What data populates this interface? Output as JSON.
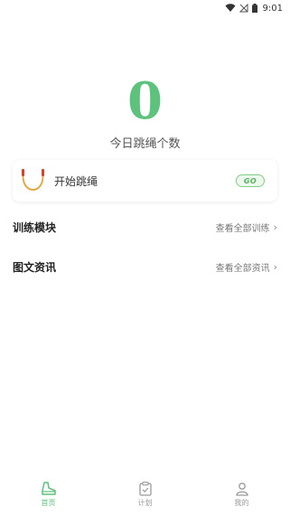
{
  "status_bar": {
    "time": "9:01"
  },
  "today": {
    "count": "0",
    "label": "今日跳绳个数"
  },
  "start_card": {
    "label": "开始跳绳",
    "badge": "GO"
  },
  "sections": [
    {
      "title": "训练模块",
      "link": "查看全部训练"
    },
    {
      "title": "图文资讯",
      "link": "查看全部资讯"
    }
  ],
  "tabs": [
    {
      "label": "首页",
      "icon": "shoe-icon",
      "active": true
    },
    {
      "label": "计划",
      "icon": "clipboard-icon",
      "active": false
    },
    {
      "label": "我的",
      "icon": "user-icon",
      "active": false
    }
  ],
  "colors": {
    "accent": "#5cc27c",
    "inactive": "#9a9a9a"
  }
}
